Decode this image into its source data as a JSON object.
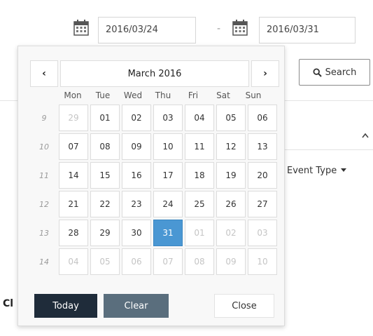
{
  "date_range": {
    "start_value": "2016/03/24",
    "end_value": "2016/03/31",
    "separator": "-"
  },
  "search_button": {
    "label": "Search",
    "icon": "search-icon"
  },
  "background": {
    "event_type_label": "Event Type",
    "dropdown_icon": "caret-down-icon",
    "collapse_icon": "chevron-up-icon",
    "partial_label": "Cl"
  },
  "calendar": {
    "month_label": "March 2016",
    "prev_label": "‹",
    "next_label": "›",
    "weekdays": [
      "Mon",
      "Tue",
      "Wed",
      "Thu",
      "Fri",
      "Sat",
      "Sun"
    ],
    "weeks": [
      {
        "number": "9",
        "days": [
          {
            "d": "29",
            "other": true
          },
          {
            "d": "01"
          },
          {
            "d": "02"
          },
          {
            "d": "03"
          },
          {
            "d": "04"
          },
          {
            "d": "05"
          },
          {
            "d": "06"
          }
        ]
      },
      {
        "number": "10",
        "days": [
          {
            "d": "07"
          },
          {
            "d": "08"
          },
          {
            "d": "09"
          },
          {
            "d": "10"
          },
          {
            "d": "11"
          },
          {
            "d": "12"
          },
          {
            "d": "13"
          }
        ]
      },
      {
        "number": "11",
        "days": [
          {
            "d": "14"
          },
          {
            "d": "15"
          },
          {
            "d": "16"
          },
          {
            "d": "17"
          },
          {
            "d": "18"
          },
          {
            "d": "19"
          },
          {
            "d": "20"
          }
        ]
      },
      {
        "number": "12",
        "days": [
          {
            "d": "21"
          },
          {
            "d": "22"
          },
          {
            "d": "23"
          },
          {
            "d": "24"
          },
          {
            "d": "25"
          },
          {
            "d": "26"
          },
          {
            "d": "27"
          }
        ]
      },
      {
        "number": "13",
        "days": [
          {
            "d": "28"
          },
          {
            "d": "29"
          },
          {
            "d": "30"
          },
          {
            "d": "31",
            "selected": true
          },
          {
            "d": "01",
            "other": true
          },
          {
            "d": "02",
            "other": true
          },
          {
            "d": "03",
            "other": true
          }
        ]
      },
      {
        "number": "14",
        "days": [
          {
            "d": "04",
            "other": true
          },
          {
            "d": "05",
            "other": true
          },
          {
            "d": "06",
            "other": true
          },
          {
            "d": "07",
            "other": true
          },
          {
            "d": "08",
            "other": true
          },
          {
            "d": "09",
            "other": true
          },
          {
            "d": "10",
            "other": true
          }
        ]
      }
    ],
    "footer": {
      "today_label": "Today",
      "clear_label": "Clear",
      "close_label": "Close"
    }
  },
  "colors": {
    "selected": "#4a97d3",
    "today_button": "#1f2c3a",
    "clear_button": "#5a6e7d"
  }
}
